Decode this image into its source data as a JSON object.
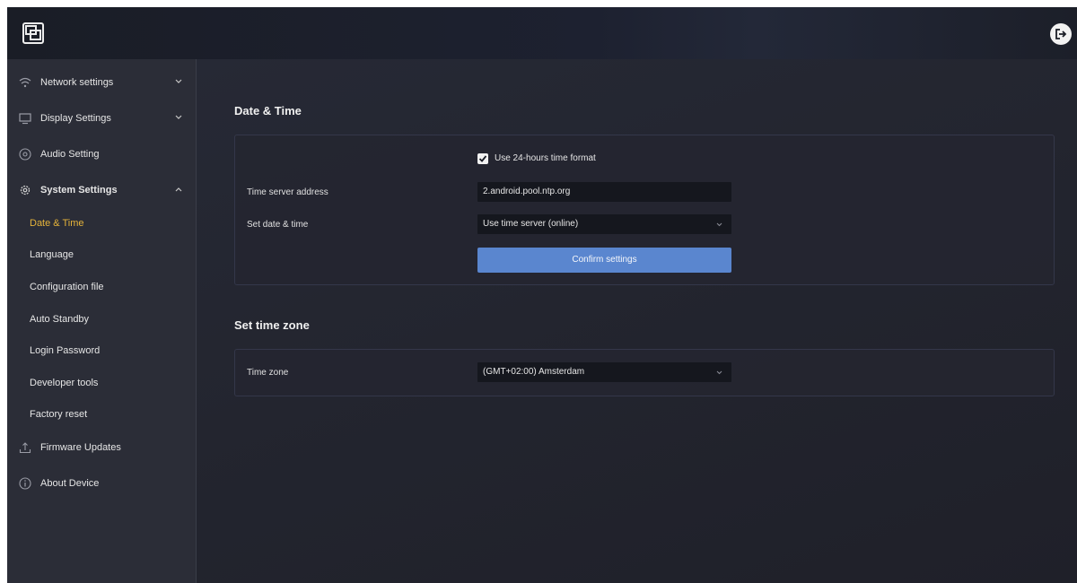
{
  "header": {
    "logo_icon": "display-screen-icon",
    "logout_icon": "logout-icon"
  },
  "sidebar": {
    "items": [
      {
        "label": "Network settings",
        "icon": "wifi-icon",
        "expanded": false
      },
      {
        "label": "Display Settings",
        "icon": "monitor-icon",
        "expanded": false
      },
      {
        "label": "Audio Setting",
        "icon": "audio-icon"
      },
      {
        "label": "System Settings",
        "icon": "gear-icon",
        "expanded": true
      },
      {
        "label": "Firmware Updates",
        "icon": "upload-icon"
      },
      {
        "label": "About Device",
        "icon": "info-icon"
      }
    ],
    "system_subitems": [
      {
        "label": "Date & Time",
        "active": true
      },
      {
        "label": "Language"
      },
      {
        "label": "Configuration file"
      },
      {
        "label": "Auto Standby"
      },
      {
        "label": "Login Password"
      },
      {
        "label": "Developer tools"
      },
      {
        "label": "Factory reset"
      }
    ]
  },
  "date_time": {
    "title": "Date & Time",
    "use_24h_label": "Use 24-hours time format",
    "use_24h_checked": true,
    "time_server_label": "Time server address",
    "time_server_value": "2.android.pool.ntp.org",
    "set_date_label": "Set date & time",
    "set_date_value": "Use time server (online)",
    "confirm_label": "Confirm settings"
  },
  "time_zone": {
    "title": "Set time zone",
    "label": "Time zone",
    "value": "(GMT+02:00) Amsterdam"
  },
  "colors": {
    "accent_active": "#e5b33a",
    "button_primary": "#5a86cf",
    "background": "#20222c"
  }
}
